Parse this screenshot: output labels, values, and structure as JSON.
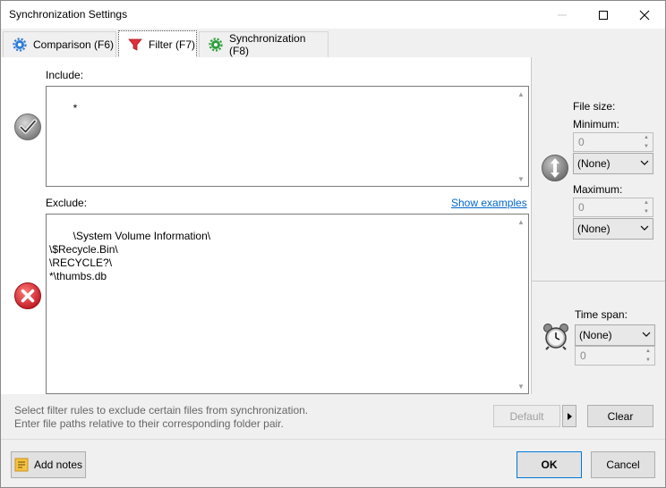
{
  "window": {
    "title": "Synchronization Settings"
  },
  "tabs": [
    {
      "label": "Comparison (F6)",
      "icon": "gear-icon-blue"
    },
    {
      "label": "Filter (F7)",
      "icon": "funnel-icon-red",
      "active": true
    },
    {
      "label": "Synchronization (F8)",
      "icon": "gear-icon-green"
    }
  ],
  "include": {
    "label": "Include:",
    "text": "*"
  },
  "exclude": {
    "label": "Exclude:",
    "show_examples": "Show examples",
    "text": "\\System Volume Information\\\n\\$Recycle.Bin\\\n\\RECYCLE?\\\n*\\thumbs.db"
  },
  "file_size": {
    "label": "File size:",
    "minimum_label": "Minimum:",
    "minimum_value": "0",
    "minimum_unit": "(None)",
    "maximum_label": "Maximum:",
    "maximum_value": "0",
    "maximum_unit": "(None)"
  },
  "time_span": {
    "label": "Time span:",
    "unit": "(None)",
    "value": "0"
  },
  "hint": {
    "line1": "Select filter rules to exclude certain files from synchronization.",
    "line2": "Enter file paths relative to their corresponding folder pair."
  },
  "buttons": {
    "default": "Default",
    "clear": "Clear",
    "add_notes": "Add notes",
    "ok": "OK",
    "cancel": "Cancel"
  },
  "colors": {
    "accent_link": "#0066cc",
    "include_check": "#8c8c8c",
    "exclude_x": "#d9363e"
  }
}
